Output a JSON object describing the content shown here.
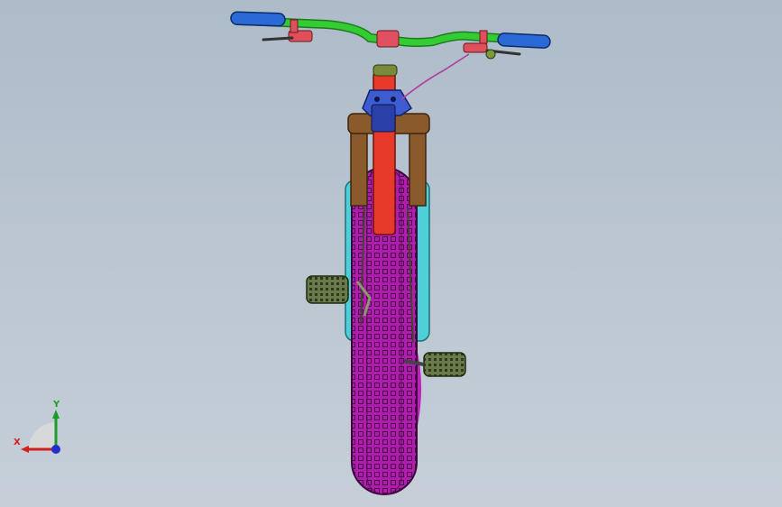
{
  "viewport": {
    "background_top": "#aebbc9",
    "background_bottom": "#c6cfd8"
  },
  "model": {
    "part_colors": {
      "handlebar": "#33cc33",
      "grips": "#2a6ad6",
      "stem": "#3c5cd0",
      "fork_crown": "#8a5a2a",
      "fork_legs": "#4fd0d8",
      "frame": "#e83a2a",
      "tire": "#c020c0",
      "pedals": "#556b3a",
      "brake_levers": "#e0505a"
    },
    "icons": [
      "bicycle-assembly-icon"
    ]
  },
  "triad": {
    "x_label": "X",
    "y_label": "Y",
    "x_color": "#d02020",
    "y_color": "#1d9c2a",
    "z_color": "#2030d0"
  }
}
